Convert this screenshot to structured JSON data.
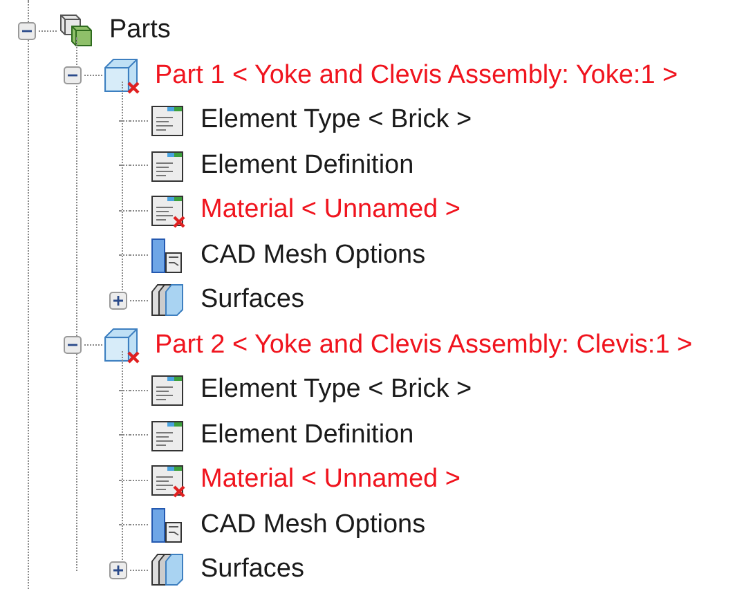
{
  "tree": {
    "label": "Parts",
    "kind": "group",
    "error": false,
    "expanded": true,
    "children": [
      {
        "label": "Part 1 < Yoke and Clevis Assembly: Yoke:1 >",
        "kind": "part",
        "error": true,
        "expanded": true,
        "children": [
          {
            "label": "Element Type < Brick >",
            "kind": "sheet",
            "error": false
          },
          {
            "label": "Element Definition",
            "kind": "sheet",
            "error": false
          },
          {
            "label": "Material < Unnamed >",
            "kind": "sheet",
            "error": true
          },
          {
            "label": "CAD Mesh Options",
            "kind": "mesh",
            "error": false
          },
          {
            "label": "Surfaces",
            "kind": "surfaces",
            "error": false,
            "expanded": false
          }
        ]
      },
      {
        "label": "Part 2 < Yoke and Clevis Assembly: Clevis:1 >",
        "kind": "part",
        "error": true,
        "expanded": true,
        "children": [
          {
            "label": "Element Type < Brick >",
            "kind": "sheet",
            "error": false
          },
          {
            "label": "Element Definition",
            "kind": "sheet",
            "error": false
          },
          {
            "label": "Material < Unnamed >",
            "kind": "sheet",
            "error": true
          },
          {
            "label": "CAD Mesh Options",
            "kind": "mesh",
            "error": false
          },
          {
            "label": "Surfaces",
            "kind": "surfaces",
            "error": false,
            "expanded": false
          }
        ]
      }
    ]
  }
}
